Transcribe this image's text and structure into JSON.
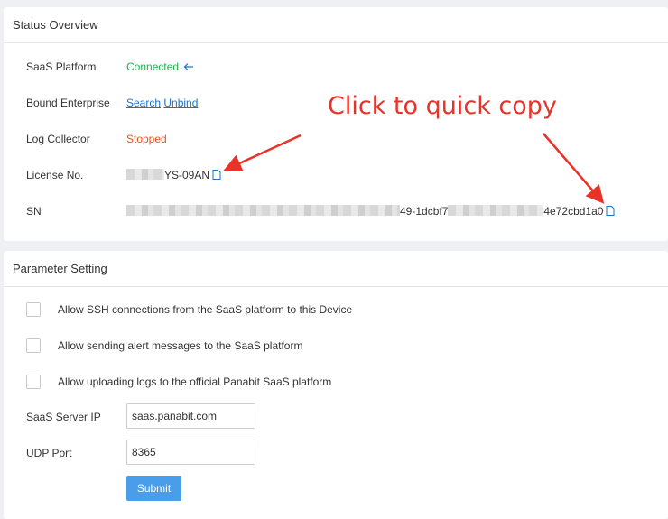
{
  "status": {
    "title": "Status Overview",
    "saas_platform": {
      "label": "SaaS Platform",
      "value": "Connected",
      "color": "#22b14c",
      "icon": "arrow-left-icon"
    },
    "bound_enterprise": {
      "label": "Bound Enterprise",
      "search_link": "Search",
      "unbind_link": "Unbind"
    },
    "log_collector": {
      "label": "Log Collector",
      "value": "Stopped",
      "color": "#e0541e"
    },
    "license": {
      "label": "License No.",
      "value_visible": "YS-09AN",
      "icon": "copy-icon"
    },
    "sn": {
      "label": "SN",
      "part1": "49-1dcbf7",
      "part2": "4e72cbd1a0",
      "icon": "copy-icon"
    }
  },
  "annotation": {
    "text": "Click to quick copy",
    "color": "#e8322a"
  },
  "params": {
    "title": "Parameter Setting",
    "checkboxes": [
      {
        "label": "Allow SSH connections from the SaaS platform to this Device",
        "checked": false
      },
      {
        "label": "Allow sending alert messages to the SaaS platform",
        "checked": false
      },
      {
        "label": "Allow uploading logs to the official Panabit SaaS platform",
        "checked": false
      }
    ],
    "server_ip": {
      "label": "SaaS Server IP",
      "value": "saas.panabit.com"
    },
    "udp_port": {
      "label": "UDP Port",
      "value": "8365"
    },
    "submit_label": "Submit",
    "accent": "#4a9de8"
  }
}
